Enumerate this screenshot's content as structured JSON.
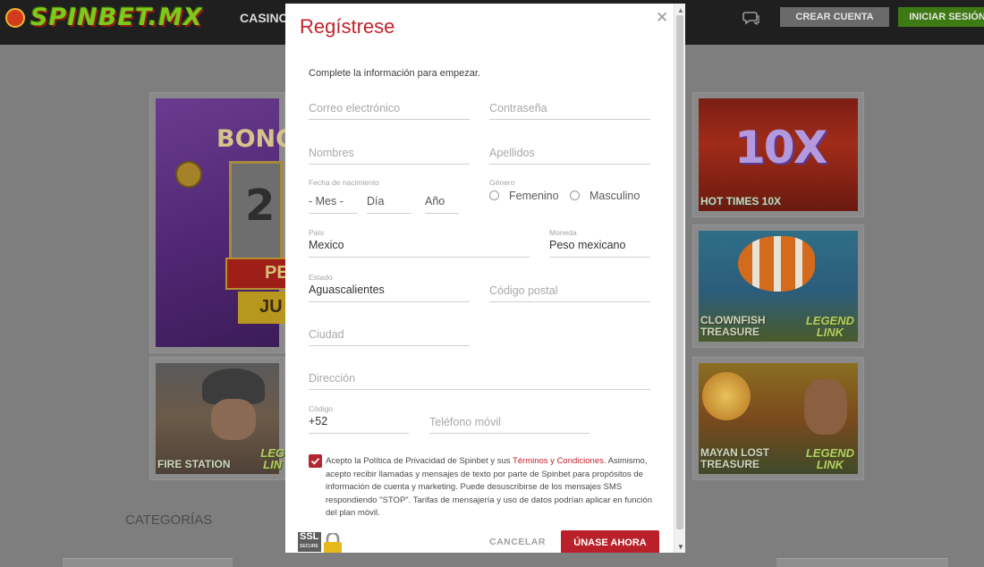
{
  "site": {
    "logo": "SPINBET.MX",
    "nav_casino": "CASINO",
    "create_account": "CREAR CUENTA",
    "login": "INICIAR SESIÓN",
    "categories_title": "CATEGORÍAS"
  },
  "promo": {
    "line1": "BONO",
    "line2": "2",
    "line3": "PE",
    "line4": "JU"
  },
  "games": [
    {
      "title": "HOT TIMES 10X",
      "art_text": "10X"
    },
    {
      "title": "CLOWNFISH TREASURE",
      "legend_line1": "LEGEND",
      "legend_line2": "LINK"
    },
    {
      "title": "FIRE STATION",
      "legend_line1": "LEG",
      "legend_line2": "LIN"
    },
    {
      "title": "MAYAN LOST TREASURE",
      "legend_line1": "LEGEND",
      "legend_line2": "LINK"
    }
  ],
  "modal": {
    "title": "Regístrese",
    "subtitle": "Complete la información para empezar.",
    "email_placeholder": "Correo electrónico",
    "password_placeholder": "Contraseña",
    "names_placeholder": "Nombres",
    "surnames_placeholder": "Apellidos",
    "birth_label": "Fecha de nacimiento",
    "month_value": "- Mes -",
    "day_placeholder": "Día",
    "year_placeholder": "Año",
    "gender_label": "Género",
    "gender_female": "Femenino",
    "gender_male": "Masculino",
    "country_label": "País",
    "country_value": "Mexico",
    "currency_label": "Moneda",
    "currency_value": "Peso mexicano",
    "state_label": "Estado",
    "state_value": "Aguascalientes",
    "postal_placeholder": "Código postal",
    "city_placeholder": "Ciudad",
    "address_placeholder": "Dirección",
    "code_label": "Código",
    "code_value": "+52",
    "phone_placeholder": "Teléfono móvil",
    "consent_prefix": "Acepto la Política de Privacidad de Spinbet y sus ",
    "consent_link": "Términos y Condiciones.",
    "consent_rest": "Asimismo, acepto recibir llamadas y mensajes de texto por parte de Spinbet para propósitos de información de cuenta y marketing. Puede desuscribirse de los mensajes SMS respondiendo \"STOP\". Tarifas de mensajería y uso de datos podrían aplicar en función del plan móvil.",
    "consent_checked": true,
    "ssl_line1": "SSL",
    "ssl_line2": "SECURE",
    "cancel": "CANCELAR",
    "submit": "ÚNASE AHORA"
  },
  "colors": {
    "accent": "#c0232c",
    "button_primary": "#ba2029",
    "login_green": "#3e7a14"
  }
}
